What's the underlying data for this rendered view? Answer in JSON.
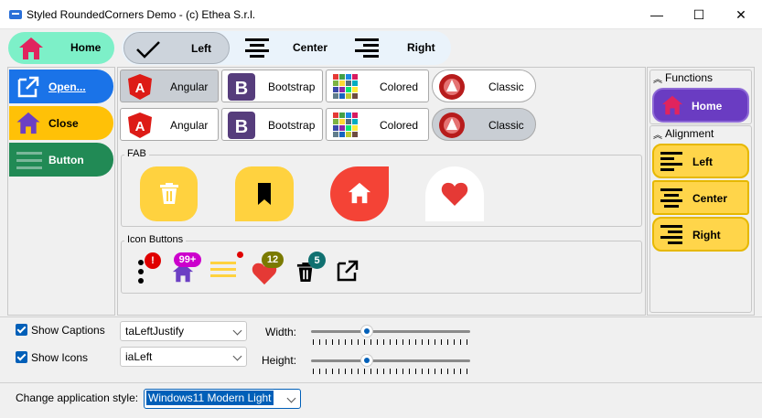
{
  "window": {
    "title": "Styled RoundedCorners Demo - (c) Ethea S.r.l.",
    "minimize_glyph": "—",
    "maximize_glyph": "☐",
    "close_glyph": "✕"
  },
  "top_left": {
    "home_label": "Home"
  },
  "alignment_tabs": {
    "left": "Left",
    "center": "Center",
    "right": "Right"
  },
  "left_buttons": {
    "open": "Open...",
    "close": "Close",
    "button": "Button"
  },
  "style_chips_row1": [
    {
      "label": "Angular"
    },
    {
      "label": "Bootstrap"
    },
    {
      "label": "Colored"
    },
    {
      "label": "Classic"
    }
  ],
  "style_chips_row2": [
    {
      "label": "Angular"
    },
    {
      "label": "Bootstrap"
    },
    {
      "label": "Colored"
    },
    {
      "label": "Classic"
    }
  ],
  "fab": {
    "title": "FAB"
  },
  "icon_buttons": {
    "title": "Icon Buttons",
    "badge_exclaim": "!",
    "badge_99": "99+",
    "badge_12": "12",
    "badge_5": "5"
  },
  "right_panel": {
    "functions_title": "Functions",
    "home_label": "Home",
    "alignment_title": "Alignment",
    "left": "Left",
    "center": "Center",
    "right": "Right"
  },
  "bottom": {
    "show_captions": "Show Captions",
    "show_icons": "Show Icons",
    "caption_align_value": "taLeftJustify",
    "icon_align_value": "iaLeft",
    "width_label": "Width:",
    "height_label": "Height:",
    "width_value_pct": 0.35,
    "height_value_pct": 0.35
  },
  "statusbar": {
    "style_label": "Change application style:",
    "style_value": "Windows11 Modern Light"
  },
  "colors": {
    "home_bg": "#7df0c8",
    "home_icon": "#e0245e",
    "open_bg": "#1a73e8",
    "close_bg": "#ffc107",
    "close_icon": "#6c3fc4",
    "button_bg": "#218a55",
    "fab_yellow": "#ffd23f",
    "fab_red": "#f44336",
    "accent": "#005fb8",
    "func_home_bg": "#6a3cc2",
    "align_yellow": "#ffd54a"
  }
}
